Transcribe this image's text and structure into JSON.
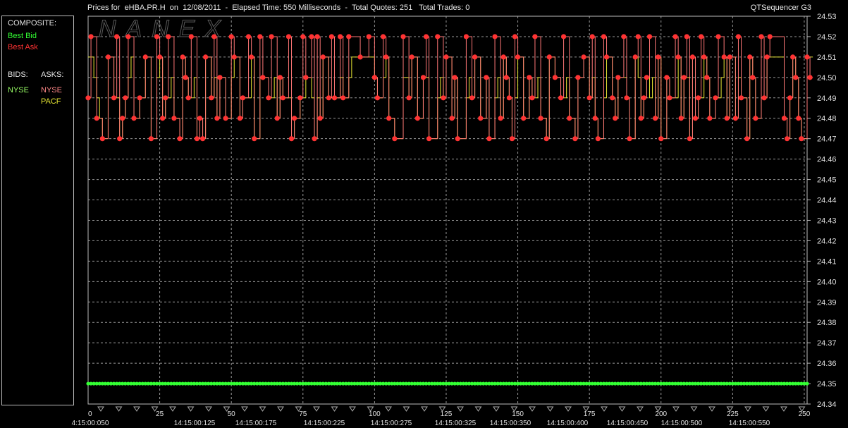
{
  "title": {
    "left": "Prices for  eHBA.PR.H  on  12/08/2011  -  Elapsed Time: 550 Milliseconds  -  Total Quotes: 251   Total Trades: 0",
    "right": "QTSequencer G3"
  },
  "watermark": "NANEX",
  "legend": {
    "composite": "COMPOSITE:",
    "best_bid": "Best Bid",
    "best_ask": "Best Ask",
    "bids": "BIDS:",
    "asks": "ASKS:",
    "bid_exchanges": [
      "NYSE"
    ],
    "ask_exchanges": [
      "NYSE",
      "PACF"
    ]
  },
  "colors": {
    "background": "#000000",
    "grid": "#9a9a9a",
    "best_bid": "#33ff33",
    "best_ask": "#ff3333",
    "nyse_ask": "#ff7777",
    "pacf_ask": "#e6e633",
    "axis_text": "#e0e0e0"
  },
  "chart_data": {
    "type": "line",
    "ylim": [
      24.34,
      24.53
    ],
    "xlim": [
      0,
      251
    ],
    "grid": true,
    "y_ticks": [
      "24.53",
      "24.52",
      "24.51",
      "24.50",
      "24.49",
      "24.48",
      "24.47",
      "24.46",
      "24.45",
      "24.44",
      "24.43",
      "24.42",
      "24.41",
      "24.40",
      "24.39",
      "24.38",
      "24.37",
      "24.36",
      "24.35",
      "24.34"
    ],
    "x_ticks": [
      0,
      25,
      50,
      75,
      100,
      125,
      150,
      175,
      200,
      225,
      250
    ],
    "x_time_labels": [
      "4:15:00:050",
      "14:15:00:125",
      "14:15:00:175",
      "14:15:00:225",
      "14:15:00:275",
      "14:15:00:325",
      "14:15:00:350",
      "14:15:00:400",
      "14:15:00:450",
      "14:15:00:500",
      "14:15:00:550"
    ],
    "series": [
      {
        "name": "Best Bid",
        "values_note": "constant",
        "constant": 24.35
      },
      {
        "name": "Best Ask",
        "values": [
          24.49,
          24.52,
          24.52,
          24.48,
          24.48,
          24.47,
          24.47,
          24.51,
          24.51,
          24.49,
          24.52,
          24.47,
          24.48,
          24.49,
          24.52,
          24.52,
          24.48,
          24.48,
          24.49,
          24.49,
          24.51,
          24.51,
          24.47,
          24.47,
          24.52,
          24.51,
          24.48,
          24.49,
          24.52,
          24.52,
          24.48,
          24.48,
          24.47,
          24.51,
          24.5,
          24.49,
          24.52,
          24.52,
          24.47,
          24.48,
          24.47,
          24.51,
          24.51,
          24.49,
          24.52,
          24.48,
          24.5,
          24.5,
          24.48,
          24.48,
          24.52,
          24.51,
          24.51,
          24.48,
          24.49,
          24.49,
          24.52,
          24.51,
          24.47,
          24.47,
          24.52,
          24.5,
          24.5,
          24.49,
          24.52,
          24.52,
          24.48,
          24.5,
          24.49,
          24.49,
          24.52,
          24.47,
          24.48,
          24.48,
          24.49,
          24.52,
          24.5,
          24.5,
          24.52,
          24.47,
          24.52,
          24.48,
          24.51,
          24.51,
          24.49,
          24.52,
          24.49,
          24.49,
          24.52,
          24.49,
          24.49,
          24.52,
          24.52,
          24.52,
          24.52,
          24.51,
          24.51,
          24.51,
          24.52,
          24.52,
          24.5,
          24.49,
          24.49,
          24.52,
          24.51,
          24.48,
          24.48,
          24.47,
          24.47,
          24.47,
          24.52,
          24.52,
          24.49,
          24.51,
          24.51,
          24.48,
          24.48,
          24.5,
          24.52,
          24.47,
          24.47,
          24.47,
          24.52,
          24.52,
          24.49,
          24.51,
          24.51,
          24.48,
          24.5,
          24.47,
          24.47,
          24.47,
          24.52,
          24.52,
          24.49,
          24.51,
          24.51,
          24.48,
          24.48,
          24.5,
          24.47,
          24.47,
          24.52,
          24.52,
          24.48,
          24.51,
          24.5,
          24.49,
          24.47,
          24.52,
          24.51,
          24.51,
          24.48,
          24.48,
          24.5,
          24.49,
          24.52,
          24.52,
          24.48,
          24.48,
          24.47,
          24.51,
          24.51,
          24.5,
          24.5,
          24.49,
          24.52,
          24.52,
          24.48,
          24.48,
          24.47,
          24.5,
          24.5,
          24.51,
          24.51,
          24.49,
          24.52,
          24.48,
          24.47,
          24.47,
          24.52,
          24.51,
          24.51,
          24.49,
          24.48,
          24.5,
          24.5,
          24.52,
          24.49,
          24.47,
          24.47,
          24.51,
          24.52,
          24.48,
          24.49,
          24.5,
          24.52,
          24.52,
          24.48,
          24.51,
          24.47,
          24.47,
          24.5,
          24.49,
          24.49,
          24.52,
          24.51,
          24.48,
          24.5,
          24.52,
          24.47,
          24.51,
          24.48,
          24.49,
          24.52,
          24.51,
          24.5,
          24.48,
          24.48,
          24.49,
          24.52,
          24.52,
          24.51,
          24.48,
          24.51,
          24.51,
          24.48,
          24.52,
          24.49,
          24.49,
          24.47,
          24.51,
          24.5,
          24.48,
          24.48,
          24.52,
          24.49,
          24.51,
          24.52,
          24.52,
          24.52,
          24.52,
          24.52,
          24.48,
          24.47,
          24.49,
          24.51,
          24.5,
          24.48,
          24.47,
          24.47,
          24.51,
          24.5
        ]
      },
      {
        "name": "PACF",
        "values": [
          24.51,
          24.51,
          24.5,
          24.49,
          24.48,
          24.47,
          24.47,
          24.51,
          24.51,
          24.49,
          24.49,
          24.47,
          24.48,
          24.49,
          24.5,
          24.51,
          24.48,
          24.48,
          24.49,
          24.49,
          24.51,
          24.51,
          24.47,
          24.47,
          24.5,
          24.51,
          24.48,
          24.49,
          24.49,
          24.5,
          24.48,
          24.48,
          24.47,
          24.51,
          24.5,
          24.49,
          24.49,
          24.5,
          24.47,
          24.48,
          24.47,
          24.51,
          24.51,
          24.49,
          24.5,
          24.48,
          24.5,
          24.5,
          24.48,
          24.48,
          24.5,
          24.51,
          24.51,
          24.48,
          24.49,
          24.49,
          24.49,
          24.51,
          24.47,
          24.47,
          24.5,
          24.5,
          24.5,
          24.49,
          24.49,
          24.5,
          24.48,
          24.5,
          24.49,
          24.49,
          24.49,
          24.47,
          24.48,
          24.48,
          24.49,
          24.49,
          24.5,
          24.5,
          24.49,
          24.47,
          24.49,
          24.48,
          24.51,
          24.51,
          24.49,
          24.49,
          24.49,
          24.49,
          24.5,
          24.49,
          24.49,
          24.5,
          24.51,
          24.51,
          24.51,
          24.51,
          24.51,
          24.51,
          24.51,
          24.51,
          24.5,
          24.49,
          24.49,
          24.5,
          24.51,
          24.48,
          24.48,
          24.47,
          24.47,
          24.47,
          24.5,
          24.5,
          24.49,
          24.51,
          24.51,
          24.48,
          24.48,
          24.5,
          24.5,
          24.47,
          24.47,
          24.47,
          24.49,
          24.5,
          24.49,
          24.51,
          24.51,
          24.48,
          24.5,
          24.47,
          24.47,
          24.47,
          24.49,
          24.5,
          24.49,
          24.51,
          24.51,
          24.48,
          24.48,
          24.5,
          24.47,
          24.47,
          24.49,
          24.5,
          24.48,
          24.51,
          24.5,
          24.49,
          24.47,
          24.49,
          24.51,
          24.51,
          24.48,
          24.48,
          24.5,
          24.49,
          24.49,
          24.5,
          24.48,
          24.48,
          24.47,
          24.51,
          24.51,
          24.5,
          24.5,
          24.49,
          24.49,
          24.5,
          24.48,
          24.48,
          24.47,
          24.5,
          24.5,
          24.51,
          24.51,
          24.49,
          24.5,
          24.48,
          24.47,
          24.47,
          24.49,
          24.51,
          24.51,
          24.49,
          24.48,
          24.5,
          24.5,
          24.5,
          24.49,
          24.47,
          24.47,
          24.51,
          24.5,
          24.48,
          24.49,
          24.5,
          24.49,
          24.5,
          24.48,
          24.51,
          24.47,
          24.47,
          24.5,
          24.49,
          24.49,
          24.49,
          24.51,
          24.48,
          24.5,
          24.5,
          24.47,
          24.51,
          24.48,
          24.49,
          24.49,
          24.51,
          24.5,
          24.48,
          24.48,
          24.49,
          24.49,
          24.5,
          24.51,
          24.48,
          24.51,
          24.51,
          24.48,
          24.5,
          24.49,
          24.49,
          24.47,
          24.51,
          24.5,
          24.48,
          24.48,
          24.49,
          24.49,
          24.51,
          24.51,
          24.51,
          24.51,
          24.51,
          24.51,
          24.48,
          24.47,
          24.49,
          24.51,
          24.5,
          24.48,
          24.47,
          24.47,
          24.51,
          24.51
        ]
      }
    ]
  }
}
